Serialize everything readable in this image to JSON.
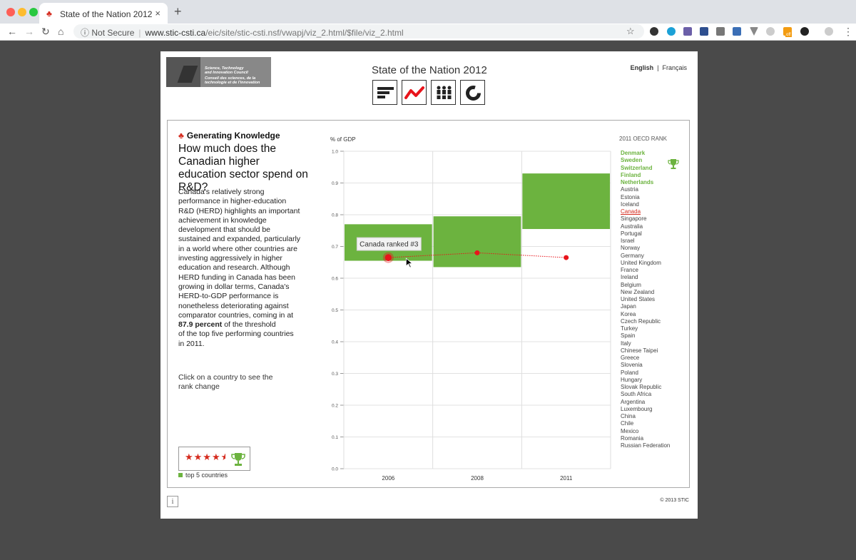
{
  "browser": {
    "tab_title": "State of the Nation 2012",
    "tab_close": "×",
    "new_tab": "+",
    "security_label": "Not Secure",
    "url_host": "www.stic-csti.ca",
    "url_path": "/eic/site/stic-csti.nsf/vwapj/viz_2.html/$file/viz_2.html",
    "ext_badge": "off"
  },
  "header": {
    "logo_en_1": "Science, Technology",
    "logo_en_2": "and Innovation Council",
    "logo_fr_1": "Conseil des sciences, de la",
    "logo_fr_2": "technologie et de l'innovation",
    "title": "State of the Nation 2012",
    "lang_en": "English",
    "lang_sep": "|",
    "lang_fr": "Français"
  },
  "content": {
    "kicker": "Generating Knowledge",
    "question": "How much does the Canadian higher education sector spend on R&D?",
    "body_lines": [
      "Canada's relatively strong",
      "performance in higher-education",
      "R&D (HERD) highlights an important",
      "achievement in knowledge",
      "development that should be",
      "sustained and expanded, particularly",
      "in a world where other countries are",
      "investing aggressively in higher",
      "education and research. Although",
      "HERD funding in Canada has been",
      "growing in dollar terms, Canada's",
      "HERD-to-GDP performance is",
      "nonetheless deteriorating against",
      "comparator countries, coming in at"
    ],
    "highlight": "87.9 percent",
    "highlight_rest": " of the threshold",
    "body_tail_1": "of the top five performing countries",
    "body_tail_2": "in 2011.",
    "hint": "Click on a country to see the rank change",
    "stars": "★★★★",
    "half_star": "★",
    "legend": "top 5 countries"
  },
  "chart_data": {
    "type": "line",
    "ylabel": "% of GDP",
    "ylim": [
      0.0,
      1.0
    ],
    "y_ticks": [
      "0.0",
      "0.1",
      "0.2",
      "0.3",
      "0.4",
      "0.5",
      "0.6",
      "0.7",
      "0.8",
      "0.9",
      "1.0"
    ],
    "categories": [
      "2006",
      "2008",
      "2011"
    ],
    "series": [
      {
        "name": "Canada",
        "values": [
          0.665,
          0.68,
          0.665
        ],
        "color": "#e8141b"
      }
    ],
    "top5_band": [
      {
        "year": "2006",
        "low": 0.655,
        "high": 0.77
      },
      {
        "year": "2008",
        "low": 0.635,
        "high": 0.795
      },
      {
        "year": "2011",
        "low": 0.755,
        "high": 0.93
      }
    ],
    "band_color": "#6cb33f",
    "tooltip": "Canada ranked #3"
  },
  "ranking": {
    "title": "2011 OECD RANK",
    "countries": [
      "Denmark",
      "Sweden",
      "Switzerland",
      "Finland",
      "Netherlands",
      "Austria",
      "Estonia",
      "Iceland",
      "Canada",
      "Singapore",
      "Australia",
      "Portugal",
      "Israel",
      "Norway",
      "Germany",
      "United Kingdom",
      "France",
      "Ireland",
      "Belgium",
      "New Zealand",
      "United States",
      "Japan",
      "Korea",
      "Czech Republic",
      "Turkey",
      "Spain",
      "Italy",
      "Chinese Taipei",
      "Greece",
      "Slovenia",
      "Poland",
      "Hungary",
      "Slovak Republic",
      "South Africa",
      "Argentina",
      "Luxembourg",
      "China",
      "Chile",
      "Mexico",
      "Romania",
      "Russian Federation"
    ],
    "top_count": 5,
    "selected": "Canada"
  },
  "footer": {
    "info": "i",
    "copyright": "© 2013 STIC"
  },
  "colors": {
    "accent_red": "#d52b1e",
    "top5_green": "#6cb33f"
  }
}
